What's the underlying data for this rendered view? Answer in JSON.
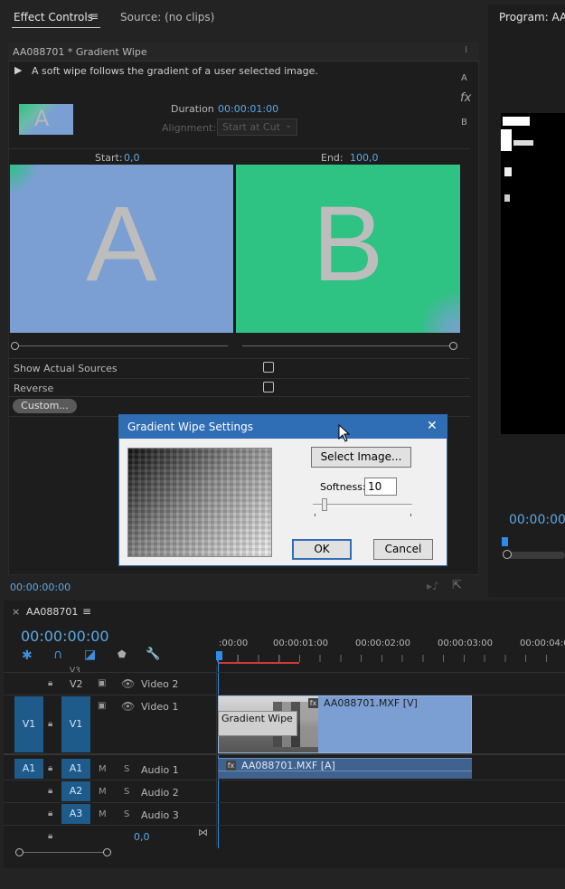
{
  "effect_controls": {
    "tab_label": "Effect Controls",
    "source_tab": "Source: (no clips)",
    "clip_header": "AA088701 * Gradient Wipe",
    "description": "A soft wipe follows the gradient of a user selected image.",
    "duration_label": "Duration",
    "duration_value": "00:00:01:00",
    "alignment_label": "Alignment:",
    "alignment_value": "Start at Cut",
    "start_label": "Start:",
    "start_value": "0,0",
    "end_label": "End:",
    "end_value": "100,0",
    "thumb_a": "A",
    "thumb_b": "B",
    "thumb_small": "A",
    "side_a": "A",
    "side_fx": "fx",
    "side_b": "B",
    "show_sources_label": "Show Actual Sources",
    "reverse_label": "Reverse",
    "custom_button": "Custom...",
    "timecode": "00:00:00:00",
    "colors": {
      "a_tile": "#7b9fd3",
      "b_tile": "#2ec283",
      "accent": "#5aa9e6"
    }
  },
  "program": {
    "title": "Program: AA0",
    "timecode": "00:00:00"
  },
  "dialog": {
    "title": "Gradient Wipe Settings",
    "close": "✕",
    "select_image": "Select Image...",
    "softness_label": "Softness:",
    "softness_value": "10",
    "softness_level": 0.1,
    "ok": "OK",
    "cancel": "Cancel"
  },
  "timeline": {
    "sequence_name": "AA088701",
    "timecode": "00:00:00:00",
    "ruler": [
      ":00:00",
      "00:00:01:00",
      "00:00:02:00",
      "00:00:03:00",
      "00:00:04:0"
    ],
    "v3_label": "V3",
    "tracks": {
      "v2": {
        "id": "V2",
        "name": "Video 2"
      },
      "v1": {
        "id": "V1",
        "src": "V1",
        "name": "Video 1"
      },
      "a1": {
        "id": "A1",
        "src": "A1",
        "m": "M",
        "s": "S",
        "name": "Audio 1"
      },
      "a2": {
        "id": "A2",
        "m": "M",
        "s": "S",
        "name": "Audio 2"
      },
      "a3": {
        "id": "A3",
        "m": "M",
        "s": "S",
        "name": "Audio 3"
      }
    },
    "master_value": "0,0",
    "transition_label": "Gradient Wipe",
    "video_clip": "AA088701.MXF [V]",
    "audio_clip": "AA088701.MXF [A]",
    "fx_badge": "fx"
  }
}
